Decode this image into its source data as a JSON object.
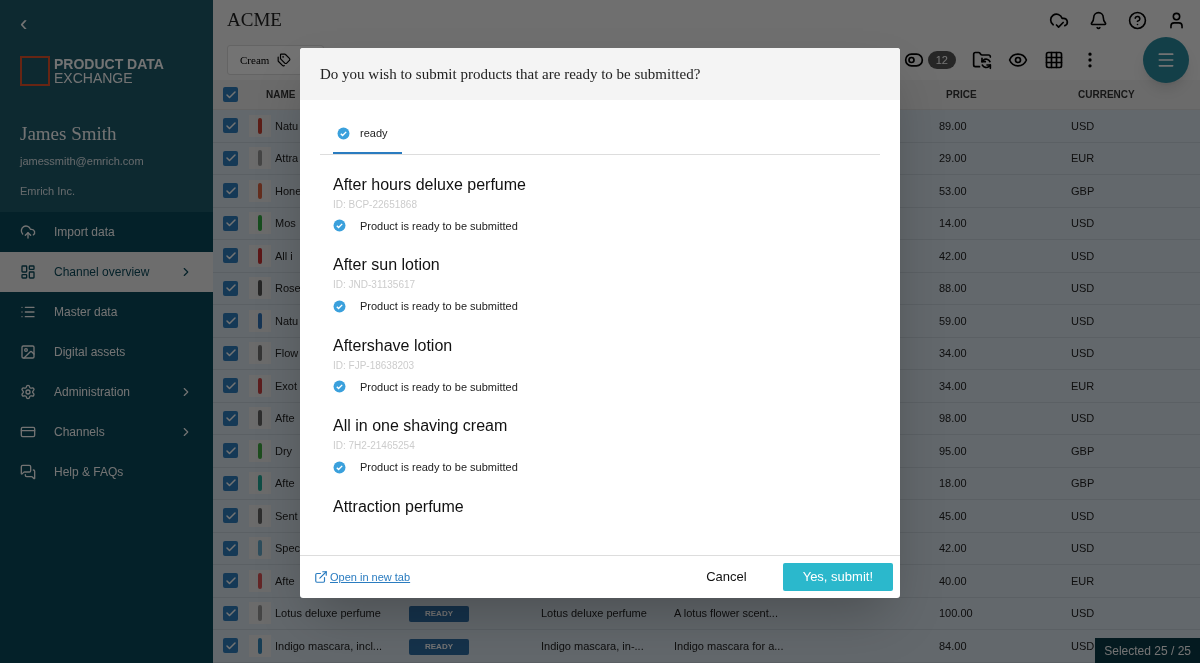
{
  "sidebar": {
    "back": "‹",
    "logo": {
      "line_1": "PRODUCT DATA",
      "line_2": "EXCHANGE"
    },
    "user": {
      "name": "James Smith",
      "email": "jamessmith@emrich.com",
      "company": "Emrich Inc."
    },
    "items": [
      {
        "label": "Import data",
        "selected": false,
        "expandable": false
      },
      {
        "label": "Channel overview",
        "selected": true,
        "expandable": true
      },
      {
        "label": "Master data",
        "selected": false,
        "expandable": false
      },
      {
        "label": "Digital assets",
        "selected": false,
        "expandable": false
      },
      {
        "label": "Administration",
        "selected": false,
        "expandable": true
      },
      {
        "label": "Channels",
        "selected": false,
        "expandable": true
      },
      {
        "label": "Help & FAQs",
        "selected": false,
        "expandable": false
      }
    ]
  },
  "header": {
    "title": "ACME"
  },
  "toolbar": {
    "filter_chip": "Cream",
    "count": "12"
  },
  "table": {
    "header_checked": true,
    "columns": {
      "name": "NAME",
      "price": "PRICE",
      "currency": "CURRENCY"
    },
    "rows": [
      {
        "checked": true,
        "name": "Natu",
        "price": "89.00",
        "currency": "USD"
      },
      {
        "checked": true,
        "name": "Attra",
        "price": "29.00",
        "currency": "EUR"
      },
      {
        "checked": true,
        "name": "Hone",
        "price": "53.00",
        "currency": "GBP"
      },
      {
        "checked": true,
        "name": "Mos",
        "price": "14.00",
        "currency": "USD"
      },
      {
        "checked": true,
        "name": "All i",
        "price": "42.00",
        "currency": "USD"
      },
      {
        "checked": true,
        "name": "Rose",
        "price": "88.00",
        "currency": "USD"
      },
      {
        "checked": true,
        "name": "Natu",
        "price": "59.00",
        "currency": "USD"
      },
      {
        "checked": true,
        "name": "Flow",
        "price": "34.00",
        "currency": "USD"
      },
      {
        "checked": true,
        "name": "Exot",
        "price": "34.00",
        "currency": "EUR"
      },
      {
        "checked": true,
        "name": "Afte",
        "price": "98.00",
        "currency": "USD"
      },
      {
        "checked": true,
        "name": "Dry",
        "price": "95.00",
        "currency": "GBP"
      },
      {
        "checked": true,
        "name": "Afte",
        "price": "18.00",
        "currency": "GBP"
      },
      {
        "checked": true,
        "name": "Sent",
        "price": "45.00",
        "currency": "USD"
      },
      {
        "checked": true,
        "name": "Spec",
        "price": "42.00",
        "currency": "USD"
      },
      {
        "checked": true,
        "name": "Afte",
        "price": "40.00",
        "currency": "EUR"
      },
      {
        "checked": true,
        "name": "Lotus deluxe perfume",
        "status": "READY",
        "column_4": "Lotus deluxe perfume",
        "column_5": "A lotus flower scent...",
        "price": "100.00",
        "currency": "USD"
      },
      {
        "checked": true,
        "name": "Indigo mascara, incl...",
        "status": "READY",
        "column_4": "Indigo mascara, in-...",
        "column_5": "Indigo mascara for a...",
        "price": "84.00",
        "currency": "USD"
      }
    ]
  },
  "selection": "Selected 25 / 25",
  "dialog": {
    "title": "Do you wish to submit products that are ready to be submitted?",
    "tabs": [
      {
        "label": "ready",
        "selected": true
      }
    ],
    "products": [
      {
        "name": "After hours deluxe perfume",
        "id": "ID: BCP-22651868",
        "message": "Product is ready to be submitted"
      },
      {
        "name": "After sun lotion",
        "id": "ID: JND-31135617",
        "message": "Product is ready to be submitted"
      },
      {
        "name": "Aftershave lotion",
        "id": "ID: FJP-18638203",
        "message": "Product is ready to be submitted"
      },
      {
        "name": "All in one shaving cream",
        "id": "ID: 7H2-21465254",
        "message": "Product is ready to be submitted"
      },
      {
        "name": "Attraction perfume"
      }
    ],
    "link": "Open in new tab",
    "cancel": "Cancel",
    "confirm": "Yes, submit!"
  }
}
